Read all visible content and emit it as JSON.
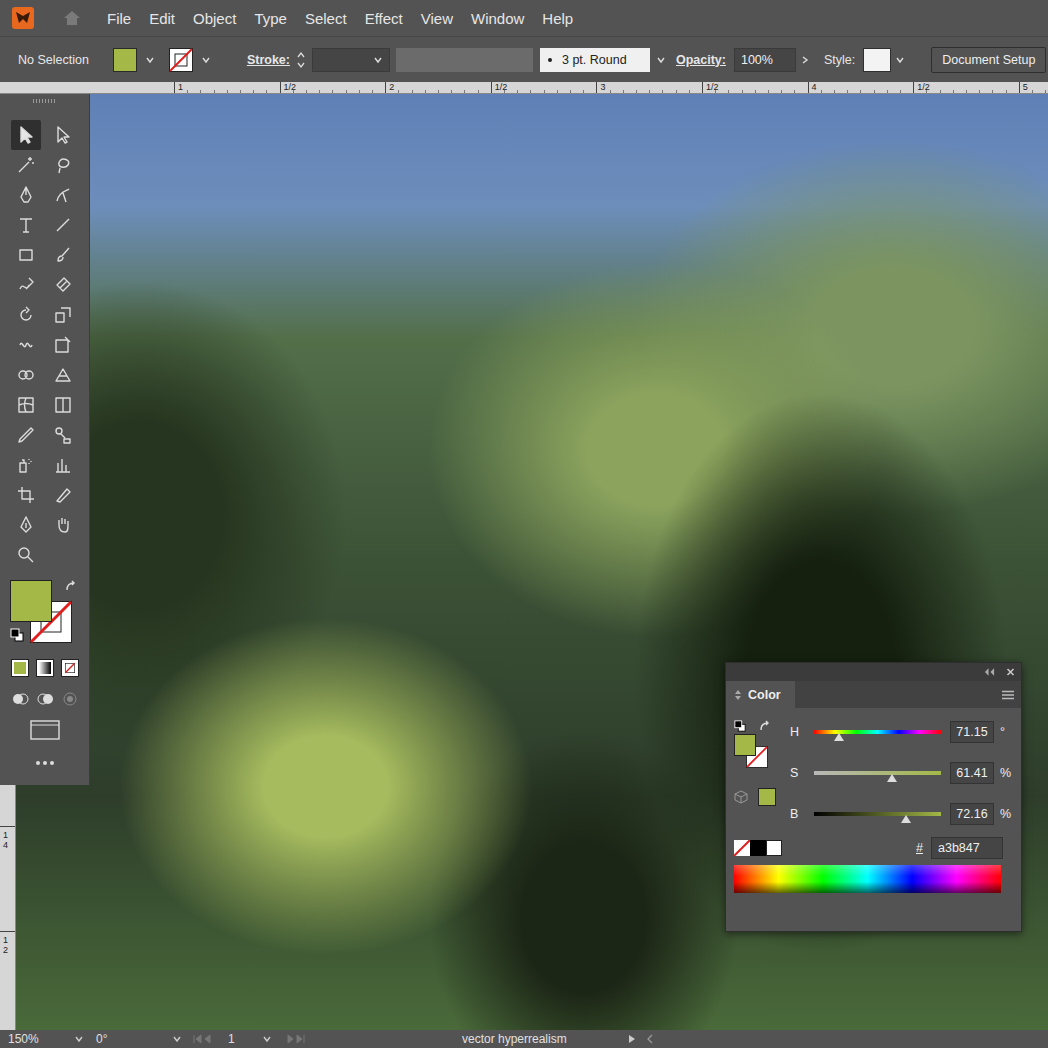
{
  "menu": [
    "File",
    "Edit",
    "Object",
    "Type",
    "Select",
    "Effect",
    "View",
    "Window",
    "Help"
  ],
  "control_bar": {
    "selection": "No Selection",
    "fill_color": "#a3b847",
    "stroke_label": "Stroke:",
    "brush": "3 pt. Round",
    "opacity_label": "Opacity:",
    "opacity": "100%",
    "style_label": "Style:",
    "document_setup": "Document Setup"
  },
  "ruler": {
    "horizontal": [
      "1",
      "1/2",
      "2",
      "1/2",
      "3",
      "1/2",
      "4",
      "1/2",
      "5"
    ],
    "vertical": [
      "14",
      "12"
    ]
  },
  "tools": [
    {
      "selected": true
    },
    {
      "selected": false
    },
    {
      "selected": false
    },
    {
      "selected": false
    },
    {
      "selected": false
    },
    {
      "selected": false
    },
    {
      "selected": false
    },
    {
      "selected": false
    },
    {
      "selected": false
    },
    {
      "selected": false
    },
    {
      "selected": false
    },
    {
      "selected": false
    },
    {
      "selected": false
    },
    {
      "selected": false
    },
    {
      "selected": false
    },
    {
      "selected": false
    },
    {
      "selected": false
    },
    {
      "selected": false
    },
    {
      "selected": false
    },
    {
      "selected": false
    },
    {
      "selected": false
    },
    {
      "selected": false
    },
    {
      "selected": false
    },
    {
      "selected": false
    },
    {
      "selected": false
    },
    {
      "selected": false
    },
    {
      "selected": false
    },
    {
      "selected": false
    },
    {
      "selected": false
    }
  ],
  "toolbar": {
    "fill_color": "#a3b847"
  },
  "color_panel": {
    "tab": "Color",
    "color": "#a3b847",
    "hex_label": "#",
    "hex": "a3b847",
    "channels": [
      {
        "name": "H",
        "kind": "hue",
        "value": "71.15",
        "unit": "°",
        "level": 0.198
      },
      {
        "name": "S",
        "kind": "saturation",
        "value": "61.41",
        "unit": "%",
        "level": 0.614
      },
      {
        "name": "B",
        "kind": "brightness",
        "value": "72.16",
        "unit": "%",
        "level": 0.722
      }
    ]
  },
  "status_bar": {
    "zoom": "150%",
    "rotation": "0°",
    "artboard": "1",
    "label": "vector hyperrealism"
  }
}
